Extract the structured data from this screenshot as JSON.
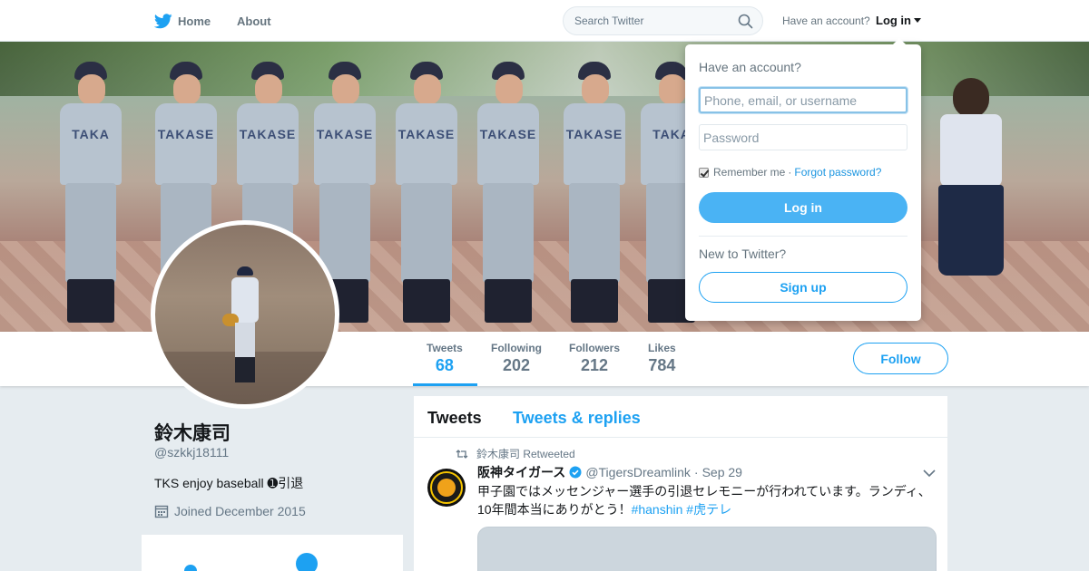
{
  "nav": {
    "home_label": "Home",
    "about_label": "About",
    "search_placeholder": "Search Twitter",
    "have_account": "Have an account?",
    "login_label": "Log in"
  },
  "login_dropdown": {
    "title": "Have an account?",
    "username_placeholder": "Phone, email, or username",
    "password_placeholder": "Password",
    "remember_label": "Remember me",
    "separator": "·",
    "forgot_label": "Forgot password?",
    "login_button": "Log in",
    "new_label": "New to Twitter?",
    "signup_button": "Sign up"
  },
  "profile": {
    "name": "鈴木康司",
    "handle": "@szkkj18111",
    "bio": "TKS enjoy baseball ➊引退",
    "joined": "Joined December 2015",
    "jersey_text": [
      "TAKA",
      "TAKASE",
      "TAKASE",
      "TAKASE",
      "TAKASE",
      "TAKASE",
      "TAKASE",
      "TAKA"
    ]
  },
  "stats": [
    {
      "label": "Tweets",
      "value": "68"
    },
    {
      "label": "Following",
      "value": "202"
    },
    {
      "label": "Followers",
      "value": "212"
    },
    {
      "label": "Likes",
      "value": "784"
    }
  ],
  "follow_button": "Follow",
  "timeline": {
    "tabs": [
      "Tweets",
      "Tweets & replies"
    ],
    "tweet": {
      "retweet_context": "鈴木康司 Retweeted",
      "author_name": "阪神タイガース",
      "author_handle": "@TigersDreamlink",
      "dot": "·",
      "date": "Sep 29",
      "text": "甲子園ではメッセンジャー選手の引退セレモニーが行われています。ランディ、10年間本当にありがとう！",
      "hashtags": "#hanshin #虎テレ"
    }
  },
  "colors": {
    "accent": "#1da1f2",
    "login_button_bg": "#4ab3f4",
    "page_bg": "#e6ecf0"
  },
  "icons": [
    "twitter-bird-icon",
    "search-icon",
    "caret-down-icon",
    "calendar-icon",
    "retweet-icon",
    "verified-icon",
    "chevron-down-icon"
  ]
}
